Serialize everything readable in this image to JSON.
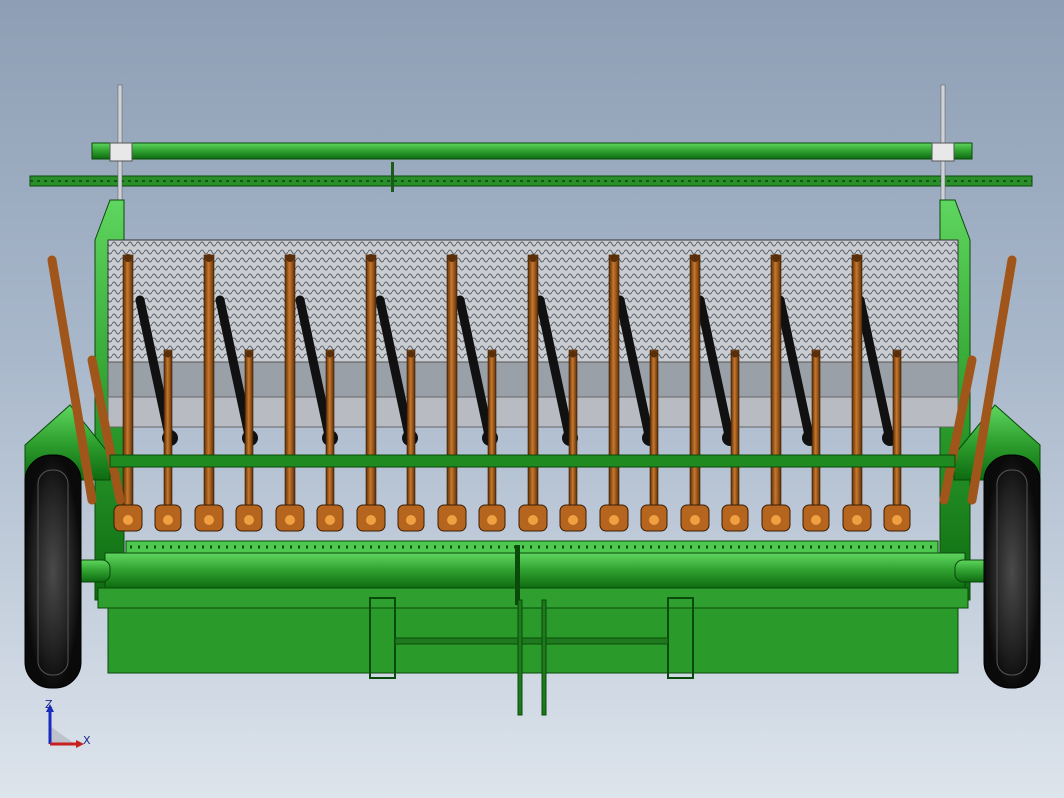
{
  "viewport": {
    "colors": {
      "frame_green": "#2fa02f",
      "frame_dark": "#0d6b10",
      "arm_brown": "#a0561a",
      "arm_dark": "#5a2e08",
      "tire_black": "#1b1b1b",
      "mesh_gray": "#9aa0a8",
      "triad_blue": "#1a2bbf",
      "triad_red": "#c8201f"
    },
    "units": {
      "upper_row_count": 10,
      "lower_row_count": 10
    }
  },
  "triad": {
    "z_label": "Z",
    "x_label": "X"
  }
}
